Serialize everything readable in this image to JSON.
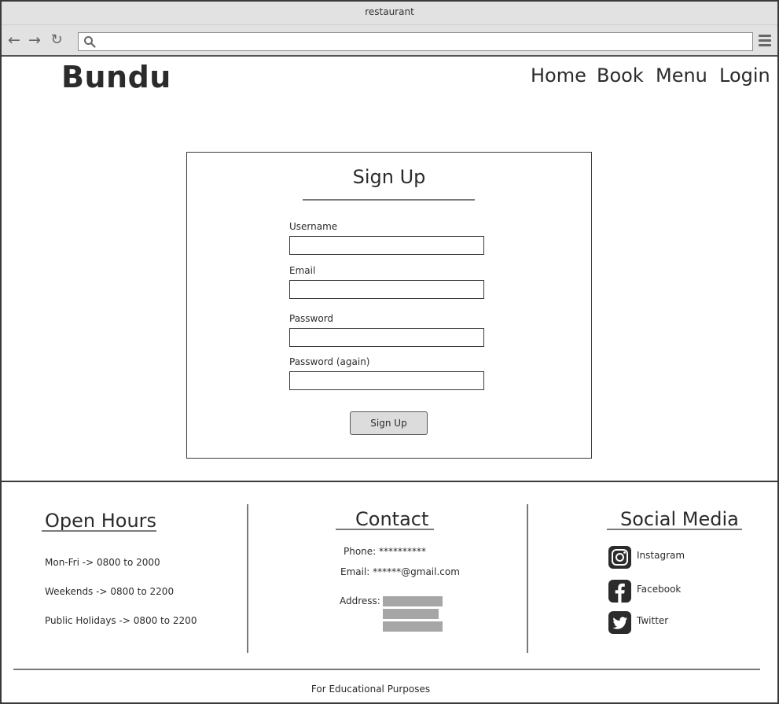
{
  "window": {
    "title": "restaurant"
  },
  "toolbar": {
    "url": ""
  },
  "header": {
    "brand": "Bundu",
    "nav": [
      "Home",
      "Book",
      "Menu",
      "Login"
    ]
  },
  "signup": {
    "title": "Sign Up",
    "fields": [
      {
        "label": "Username",
        "value": ""
      },
      {
        "label": "Email",
        "value": ""
      },
      {
        "label": "Password",
        "value": ""
      },
      {
        "label": "Password (again)",
        "value": ""
      }
    ],
    "button": "Sign Up"
  },
  "footer": {
    "hours": {
      "title": "Open Hours",
      "lines": [
        "Mon-Fri -> 0800 to 2000",
        "Weekends -> 0800 to 2200",
        "Public Holidays -> 0800 to 2200"
      ]
    },
    "contact": {
      "title": "Contact",
      "phone": "Phone: **********",
      "email": "Email: ******@gmail.com",
      "address_label": "Address:"
    },
    "social": {
      "title": "Social Media",
      "items": [
        {
          "label": "Instagram",
          "icon": "instagram-icon"
        },
        {
          "label": "Facebook",
          "icon": "facebook-icon"
        },
        {
          "label": "Twitter",
          "icon": "twitter-icon"
        }
      ]
    },
    "note": "For Educational Purposes"
  }
}
